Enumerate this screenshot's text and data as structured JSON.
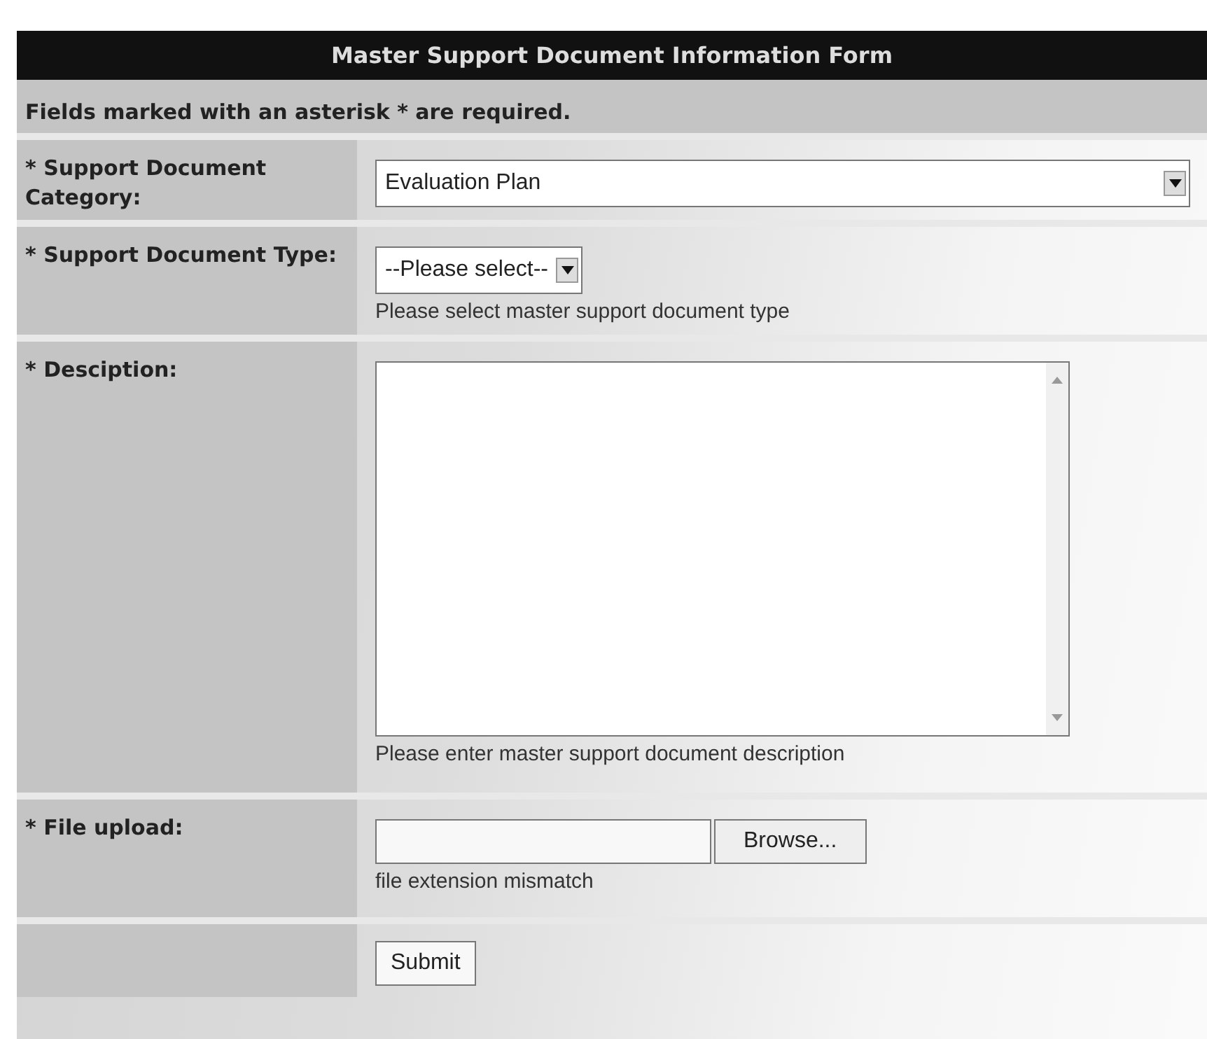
{
  "form": {
    "title": "Master Support Document Information Form",
    "notice": "Fields marked with an asterisk * are required.",
    "rows": [
      {
        "kind": "select",
        "label": "* Support Document Category:",
        "value": "Evaluation Plan",
        "wide": true
      },
      {
        "kind": "select",
        "label": "* Support Document Type:",
        "value": "--Please select--",
        "wide": false,
        "hint": "Please select master support document type"
      },
      {
        "kind": "textarea",
        "label": "* Desciption:",
        "hint": "Please enter master support document description"
      },
      {
        "kind": "file",
        "label": "* File upload:",
        "button": "Browse...",
        "hint": "file extension mismatch"
      },
      {
        "kind": "submit",
        "button": "Submit"
      }
    ]
  }
}
